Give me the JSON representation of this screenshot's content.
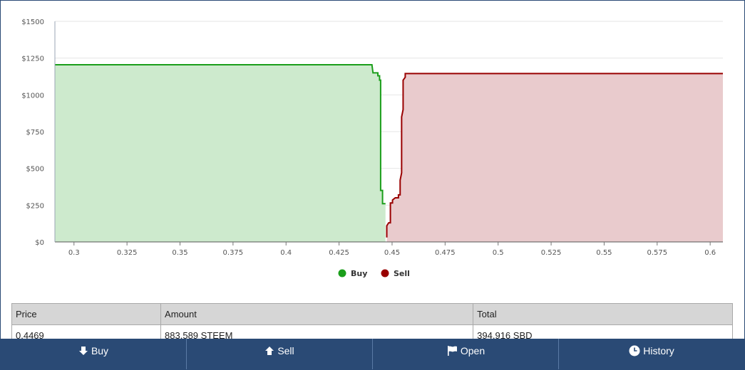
{
  "chart_data": {
    "type": "area",
    "title": "",
    "xlabel": "",
    "ylabel": "",
    "xlim": [
      0.291,
      0.606
    ],
    "ylim": [
      0,
      1500
    ],
    "x_ticks": [
      "0.3",
      "0.325",
      "0.35",
      "0.375",
      "0.4",
      "0.425",
      "0.45",
      "0.475",
      "0.5",
      "0.525",
      "0.55",
      "0.575",
      "0.6"
    ],
    "x_tick_values": [
      0.3,
      0.325,
      0.35,
      0.375,
      0.4,
      0.425,
      0.45,
      0.475,
      0.5,
      0.525,
      0.55,
      0.575,
      0.6
    ],
    "y_ticks": [
      "$0",
      "$250",
      "$500",
      "$750",
      "$1000",
      "$1250",
      "$1500"
    ],
    "y_tick_values": [
      0,
      250,
      500,
      750,
      1000,
      1250,
      1500
    ],
    "grid": true,
    "legend_position": "bottom-center",
    "series": [
      {
        "name": "Buy",
        "color": "#1a9e1a",
        "fill": "#cdeacd",
        "points": [
          [
            0.291,
            1205
          ],
          [
            0.4405,
            1205
          ],
          [
            0.441,
            1150
          ],
          [
            0.4433,
            1150
          ],
          [
            0.4433,
            1130
          ],
          [
            0.4441,
            1130
          ],
          [
            0.4441,
            1100
          ],
          [
            0.4446,
            1100
          ],
          [
            0.4446,
            350
          ],
          [
            0.4455,
            350
          ],
          [
            0.4455,
            260
          ],
          [
            0.4469,
            260
          ]
        ]
      },
      {
        "name": "Sell",
        "color": "#990000",
        "fill": "#e9cbcd",
        "points": [
          [
            0.4475,
            30
          ],
          [
            0.4475,
            110
          ],
          [
            0.4484,
            130
          ],
          [
            0.4492,
            130
          ],
          [
            0.4492,
            265
          ],
          [
            0.4502,
            265
          ],
          [
            0.4502,
            285
          ],
          [
            0.4515,
            300
          ],
          [
            0.453,
            300
          ],
          [
            0.453,
            320
          ],
          [
            0.4538,
            320
          ],
          [
            0.4538,
            420
          ],
          [
            0.4545,
            470
          ],
          [
            0.4545,
            850
          ],
          [
            0.4552,
            900
          ],
          [
            0.4552,
            1100
          ],
          [
            0.4562,
            1120
          ],
          [
            0.4562,
            1145
          ],
          [
            0.606,
            1145
          ]
        ]
      }
    ]
  },
  "table": {
    "headers": [
      "Price",
      "Amount",
      "Total"
    ],
    "row": [
      "0.4469",
      "883.589 STEEM",
      "394.916 SBD"
    ]
  },
  "nav": {
    "buy": "Buy",
    "sell": "Sell",
    "open": "Open",
    "history": "History"
  },
  "icons": [
    "arrow-down-icon",
    "arrow-up-icon",
    "flag-icon",
    "clock-icon"
  ]
}
